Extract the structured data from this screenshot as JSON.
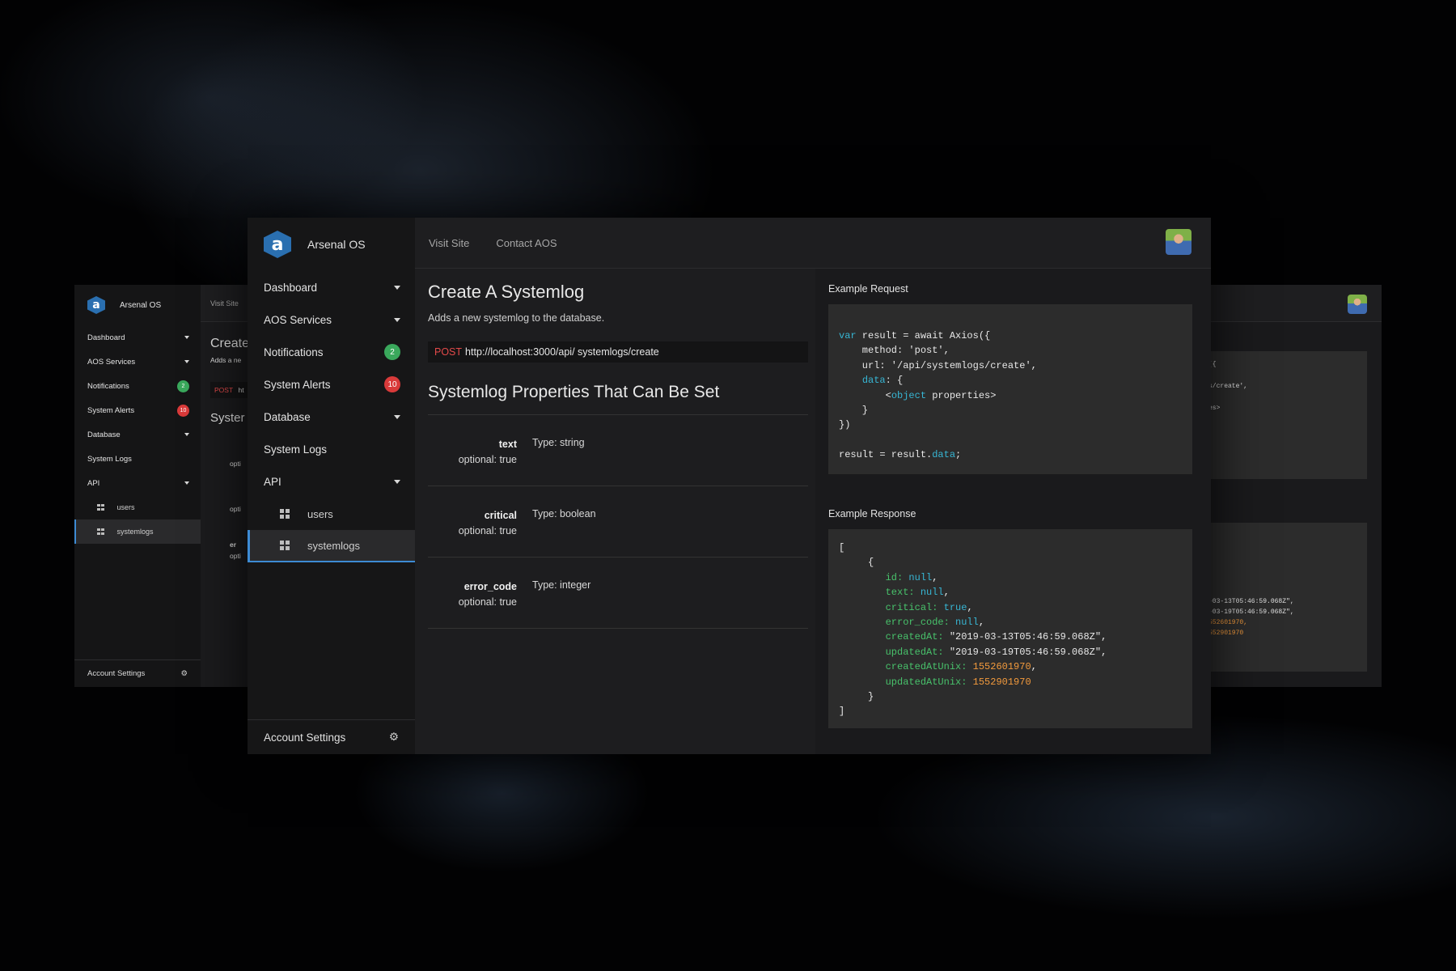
{
  "app": {
    "name": "Arsenal OS",
    "logo_letter": "a"
  },
  "sidebar": {
    "items": [
      {
        "label": "Dashboard",
        "has_caret": true
      },
      {
        "label": "AOS Services",
        "has_caret": true
      },
      {
        "label": "Notifications",
        "badge": "2",
        "badge_color": "#3aa85c"
      },
      {
        "label": "System Alerts",
        "badge": "10",
        "badge_color": "#d93a3a"
      },
      {
        "label": "Database",
        "has_caret": true
      },
      {
        "label": "System Logs"
      },
      {
        "label": "API",
        "has_caret": true
      }
    ],
    "api_children": [
      {
        "label": "users",
        "active": false
      },
      {
        "label": "systemlogs",
        "active": true
      }
    ],
    "account_label": "Account Settings"
  },
  "topbar": {
    "links": [
      "Visit Site",
      "Contact AOS"
    ]
  },
  "content": {
    "title": "Create A Systemlog",
    "description": "Adds a new systemlog to the database.",
    "method": "POST",
    "url": "http://localhost:3000/api/ systemlogs/create",
    "properties_title": "Systemlog Properties That Can Be Set",
    "properties": [
      {
        "name": "text",
        "optional": "optional: true",
        "type": "Type: string"
      },
      {
        "name": "critical",
        "optional": "optional: true",
        "type": "Type: boolean"
      },
      {
        "name": "error_code",
        "optional": "optional: true",
        "type": "Type: integer"
      }
    ]
  },
  "examples": {
    "request_label": "Example Request",
    "response_label": "Example Response",
    "request_code": {
      "l1a": "var",
      "l1b": " result = await Axios({",
      "l2": "    method: 'post',",
      "l3": "    url: '/api/systemlogs/create',",
      "l4a": "    ",
      "l4b": "data",
      "l4c": ": {",
      "l5a": "        <",
      "l5b": "object",
      "l5c": " properties>",
      "l6": "    }",
      "l7": "})",
      "l9a": "result = result.",
      "l9b": "data",
      "l9c": ";"
    },
    "response_code": {
      "open": "[",
      "obj_open": "     {",
      "id_k": "id:",
      "id_v": "null",
      "text_k": "text:",
      "text_v": "null",
      "critical_k": "critical:",
      "critical_v": "true",
      "error_k": "error_code:",
      "error_v": "null",
      "created_k": "createdAt:",
      "created_v": "\"2019-03-13T05:46:59.068Z\"",
      "updated_k": "updatedAt:",
      "updated_v": "\"2019-03-19T05:46:59.068Z\"",
      "cunix_k": "createdAtUnix:",
      "cunix_v": "1552601970",
      "uunix_k": "updatedAtUnix:",
      "uunix_v": "1552901970",
      "obj_close": "     }",
      "close": "]"
    }
  },
  "back_left": {
    "topbar_link": "Visit Site",
    "title_peek": "Create",
    "desc_peek": "Adds a ne",
    "method": "POST",
    "url_peek": "ht",
    "props_peek": "Syster",
    "optional_peek": [
      "opti",
      "opti",
      "opti"
    ],
    "error_peek": "er"
  },
  "back_right": {
    "request_peek": [
      "({",
      "s/create',",
      "es>"
    ],
    "response_peek": [
      ",",
      "-03-13T05:46:59.068Z\",",
      "-03-19T05:46:59.068Z\",",
      "552601970,",
      "552901970"
    ]
  },
  "colors": {
    "accent": "#3d8bd4",
    "post": "#e34a4a",
    "keyword": "#37b6d4",
    "key_green": "#48c26b",
    "number": "#f29a3d"
  }
}
